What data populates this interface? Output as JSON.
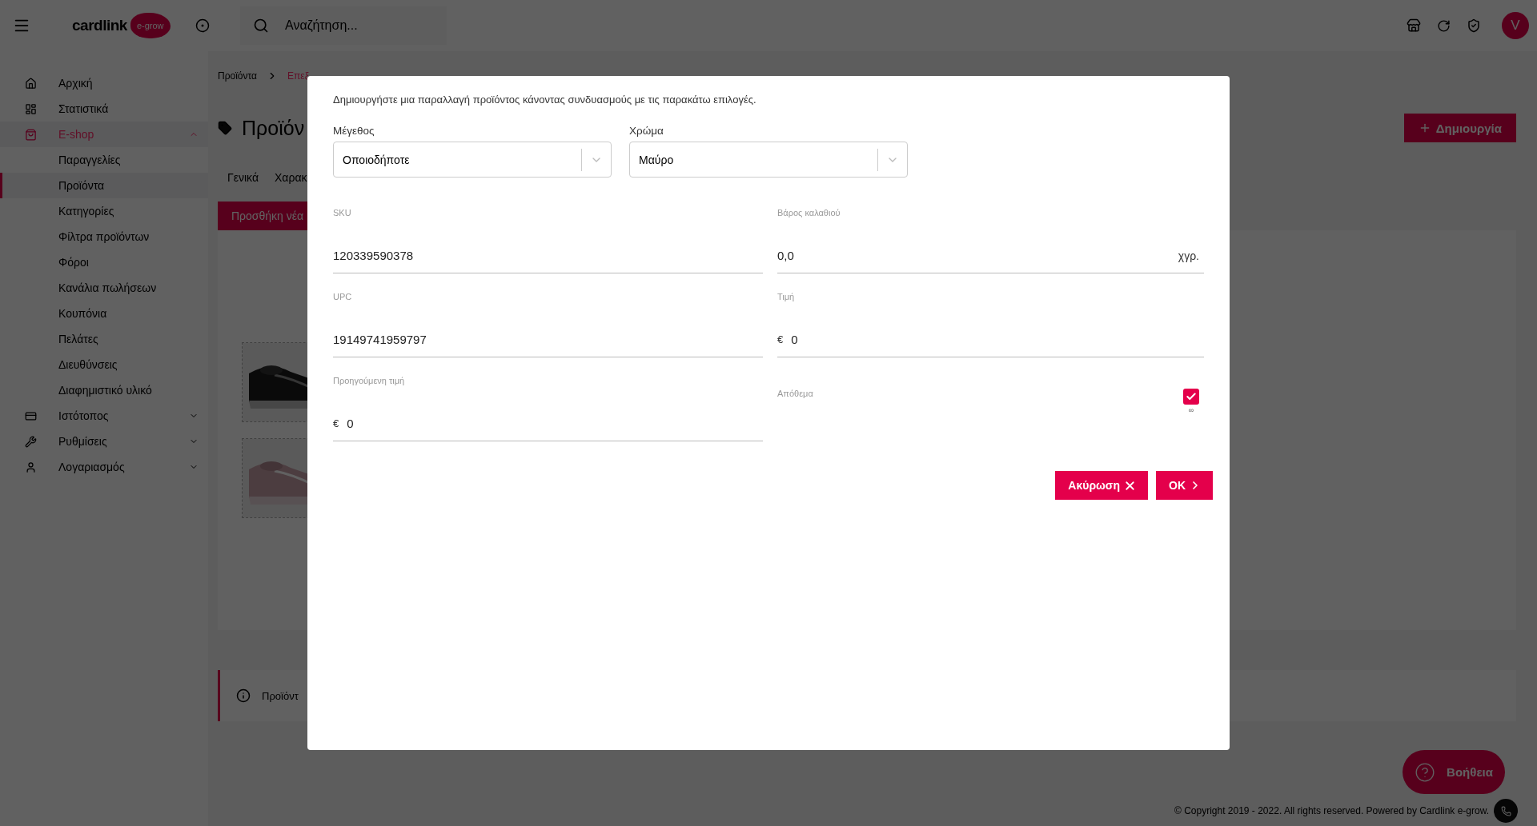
{
  "topbar": {
    "logo": "cardlink",
    "logo_badge": "e-grow",
    "search": {
      "placeholder": "Αναζήτηση..."
    },
    "avatar": "V"
  },
  "sidebar": {
    "items": [
      {
        "label": "Αρχική",
        "selected": false
      },
      {
        "label": "Στατιστικά",
        "selected": false
      },
      {
        "label": "E-shop",
        "selected": true,
        "expanded": true,
        "children": [
          {
            "label": "Παραγγελίες",
            "selected": false
          },
          {
            "label": "Προϊόντα",
            "selected": true
          },
          {
            "label": "Κατηγορίες",
            "selected": false
          },
          {
            "label": "Φίλτρα προϊόντων",
            "selected": false
          },
          {
            "label": "Φόροι",
            "selected": false
          },
          {
            "label": "Κανάλια πωλήσεων",
            "selected": false
          },
          {
            "label": "Κουπόνια",
            "selected": false
          },
          {
            "label": "Πελάτες",
            "selected": false
          },
          {
            "label": "Διευθύνσεις",
            "selected": false
          },
          {
            "label": "Διαφημιστικό υλικό",
            "selected": false
          }
        ]
      },
      {
        "label": "Ιστότοπος",
        "selected": false,
        "expanded": false
      },
      {
        "label": "Ρυθμίσεις",
        "selected": false,
        "expanded": false
      },
      {
        "label": "Λογαριασμός",
        "selected": false,
        "expanded": false
      }
    ]
  },
  "page": {
    "breadcrumb": [
      "Προϊόντα",
      "Επεξ"
    ],
    "title": "Προϊόν",
    "tabs": [
      "Γενικά",
      "Χαρακ"
    ],
    "add_button": "Προσθήκη νέα",
    "create_button": "Δημιουργία",
    "info_text": "Προϊόντ"
  },
  "modal": {
    "description": "Δημιουργήστε μια παραλλαγή προϊόντος κάνοντας συνδυασμούς με τις παρακάτω επιλογές.",
    "selects": [
      {
        "label": "Μέγεθος",
        "value": "Οποιοδήποτε"
      },
      {
        "label": "Χρώμα",
        "value": "Μαύρο"
      }
    ],
    "fields": [
      {
        "kind": "text",
        "label": "SKU",
        "value": "120339590378"
      },
      {
        "kind": "text",
        "label": "Βάρος καλαθιού",
        "value": "0,0",
        "suffix": "χγρ."
      },
      {
        "kind": "text",
        "label": "UPC",
        "value": "19149741959797"
      },
      {
        "kind": "text",
        "label": "Τιμή",
        "prefix": "€",
        "value": "0"
      },
      {
        "kind": "text",
        "label": "Προηγούμενη τιμή",
        "prefix": "€",
        "value": "0"
      },
      {
        "kind": "checkbox",
        "label": "Απόθεμα",
        "checked": true,
        "note": "∞"
      }
    ],
    "buttons": [
      {
        "kind": "cancel",
        "label": "Ακύρωση"
      },
      {
        "kind": "ok",
        "label": "OK"
      }
    ]
  },
  "help_button": "Βοήθεια",
  "footer": "© Copyright 2019 - 2022. All rights reserved. Powered by Cardlink e-grow."
}
